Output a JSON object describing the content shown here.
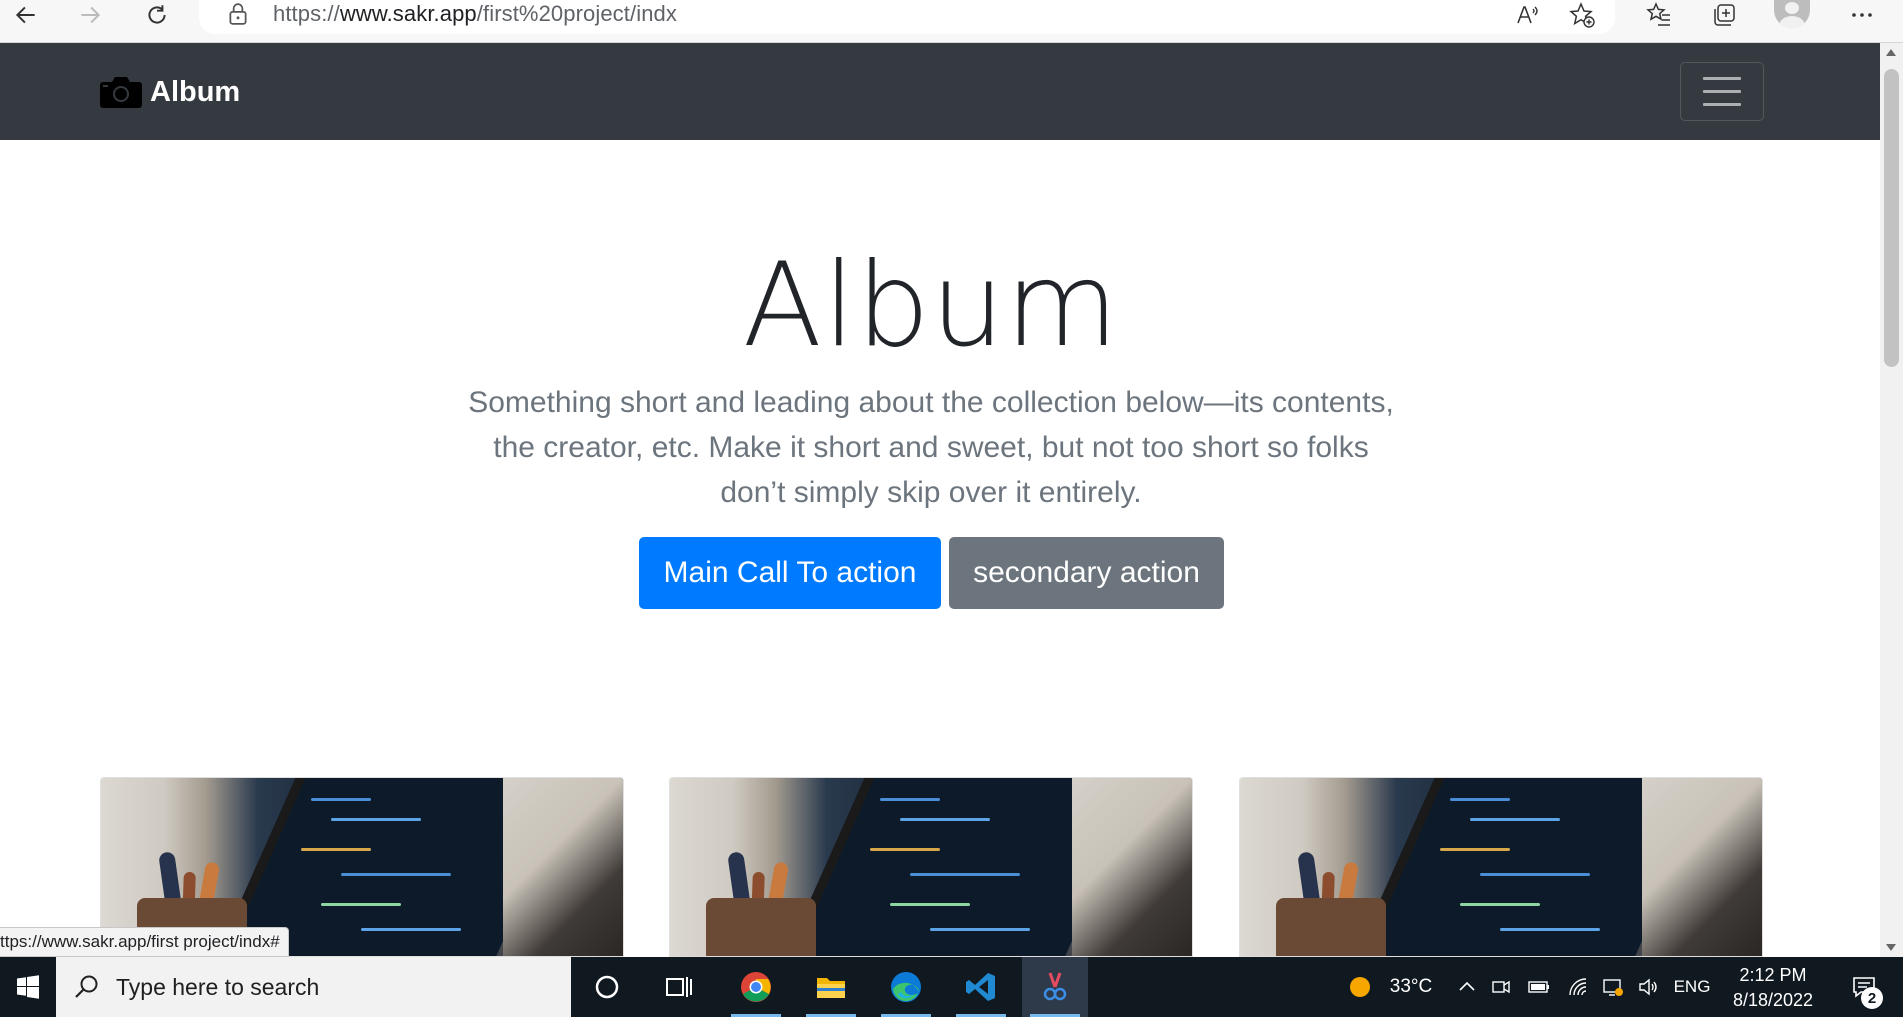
{
  "browser": {
    "url_prefix": "https://",
    "url_domain": "www.sakr.app",
    "url_path": "/first%20project/indx"
  },
  "navbar": {
    "brand": "Album",
    "brand_icon": "camera-icon"
  },
  "hero": {
    "title": "Album",
    "lead": "Something short and leading about the collection below—its contents, the creator, etc. Make it short and sweet, but not too short so folks don’t simply skip over it entirely.",
    "primary_button": "Main Call To action",
    "secondary_button": "secondary action"
  },
  "cards": [
    {
      "image": "laptop-code-photo"
    },
    {
      "image": "laptop-code-photo"
    },
    {
      "image": "laptop-code-photo"
    }
  ],
  "status_url": "ttps://www.sakr.app/first project/indx#",
  "taskbar": {
    "search_placeholder": "Type here to search",
    "weather": "33°C",
    "language": "ENG",
    "time": "2:12 PM",
    "date": "8/18/2022",
    "notification_count": "2"
  },
  "colors": {
    "navbar_bg": "#343a40",
    "primary": "#007bff",
    "secondary": "#6c757d",
    "taskbar_bg": "#101820"
  }
}
